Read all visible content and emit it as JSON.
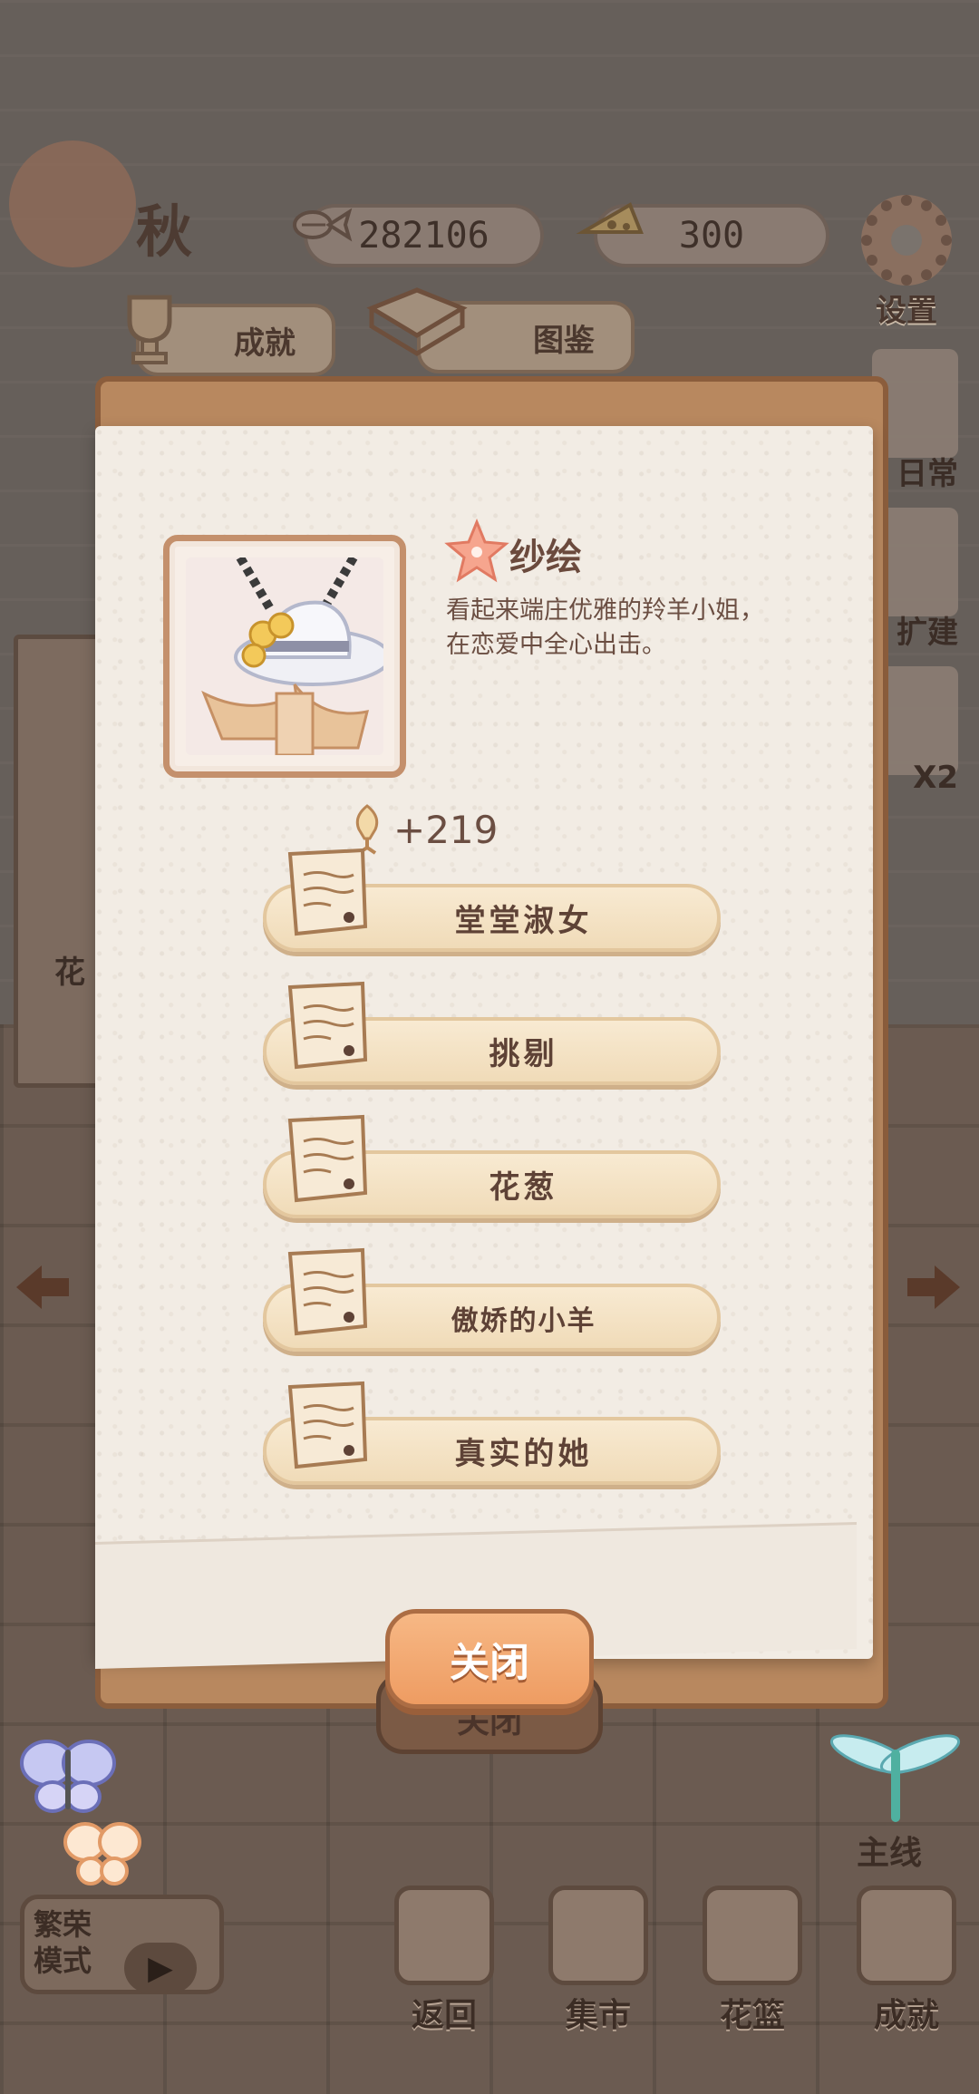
{
  "hud": {
    "season": "秋",
    "fish_count": "282106",
    "cheese_count": "300",
    "settings_label": "设置"
  },
  "tabs": {
    "achievement": "成就",
    "encyclopedia": "图鉴"
  },
  "right_rail": {
    "daily": "日常",
    "build": "扩建",
    "boost": "X2",
    "mainline": "主线"
  },
  "left_shelf": {
    "label": "花"
  },
  "character": {
    "name": "纱绘",
    "description": "看起来端庄优雅的羚羊小姐，在恋爱中全心出击。"
  },
  "reward": {
    "value": "+219"
  },
  "stories": [
    {
      "label": "堂堂淑女"
    },
    {
      "label": "挑剔"
    },
    {
      "label": "花葱"
    },
    {
      "label": "傲娇的小羊"
    },
    {
      "label": "真实的她"
    }
  ],
  "dialog": {
    "close_label": "关闭",
    "close_shadow_label": "关闭"
  },
  "bottom_nav": {
    "mode_label": "繁荣模式",
    "items": [
      {
        "label": "返回"
      },
      {
        "label": "集市"
      },
      {
        "label": "花篮"
      },
      {
        "label": "成就"
      }
    ]
  },
  "colors": {
    "paper": "#f2ece4",
    "button_cream": "#f4e2c4",
    "close_orange": "#ee9c62",
    "text_brown": "#5e4236"
  }
}
